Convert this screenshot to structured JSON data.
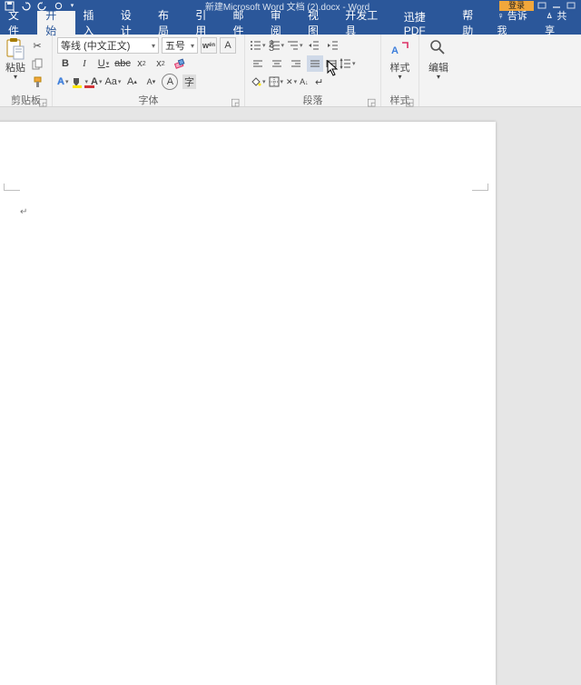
{
  "title": "新建Microsoft Word 文档 (2).docx - Word",
  "login": "登录",
  "tabs": [
    "文件",
    "开始",
    "插入",
    "设计",
    "布局",
    "引用",
    "邮件",
    "审阅",
    "视图",
    "开发工具",
    "迅捷PDF",
    "帮助"
  ],
  "active_tab": 1,
  "tellme_icon": "♀",
  "tellme": "告诉我",
  "share": "共享",
  "groups": {
    "clipboard": {
      "paste": "粘贴",
      "label": "剪贴板"
    },
    "font": {
      "name": "等线 (中文正文)",
      "size": "五号",
      "label": "字体"
    },
    "paragraph": {
      "label": "段落"
    },
    "styles": {
      "btn": "样式",
      "label": "样式"
    },
    "editing": {
      "btn": "编辑"
    }
  },
  "page": {
    "caret": "↵"
  }
}
